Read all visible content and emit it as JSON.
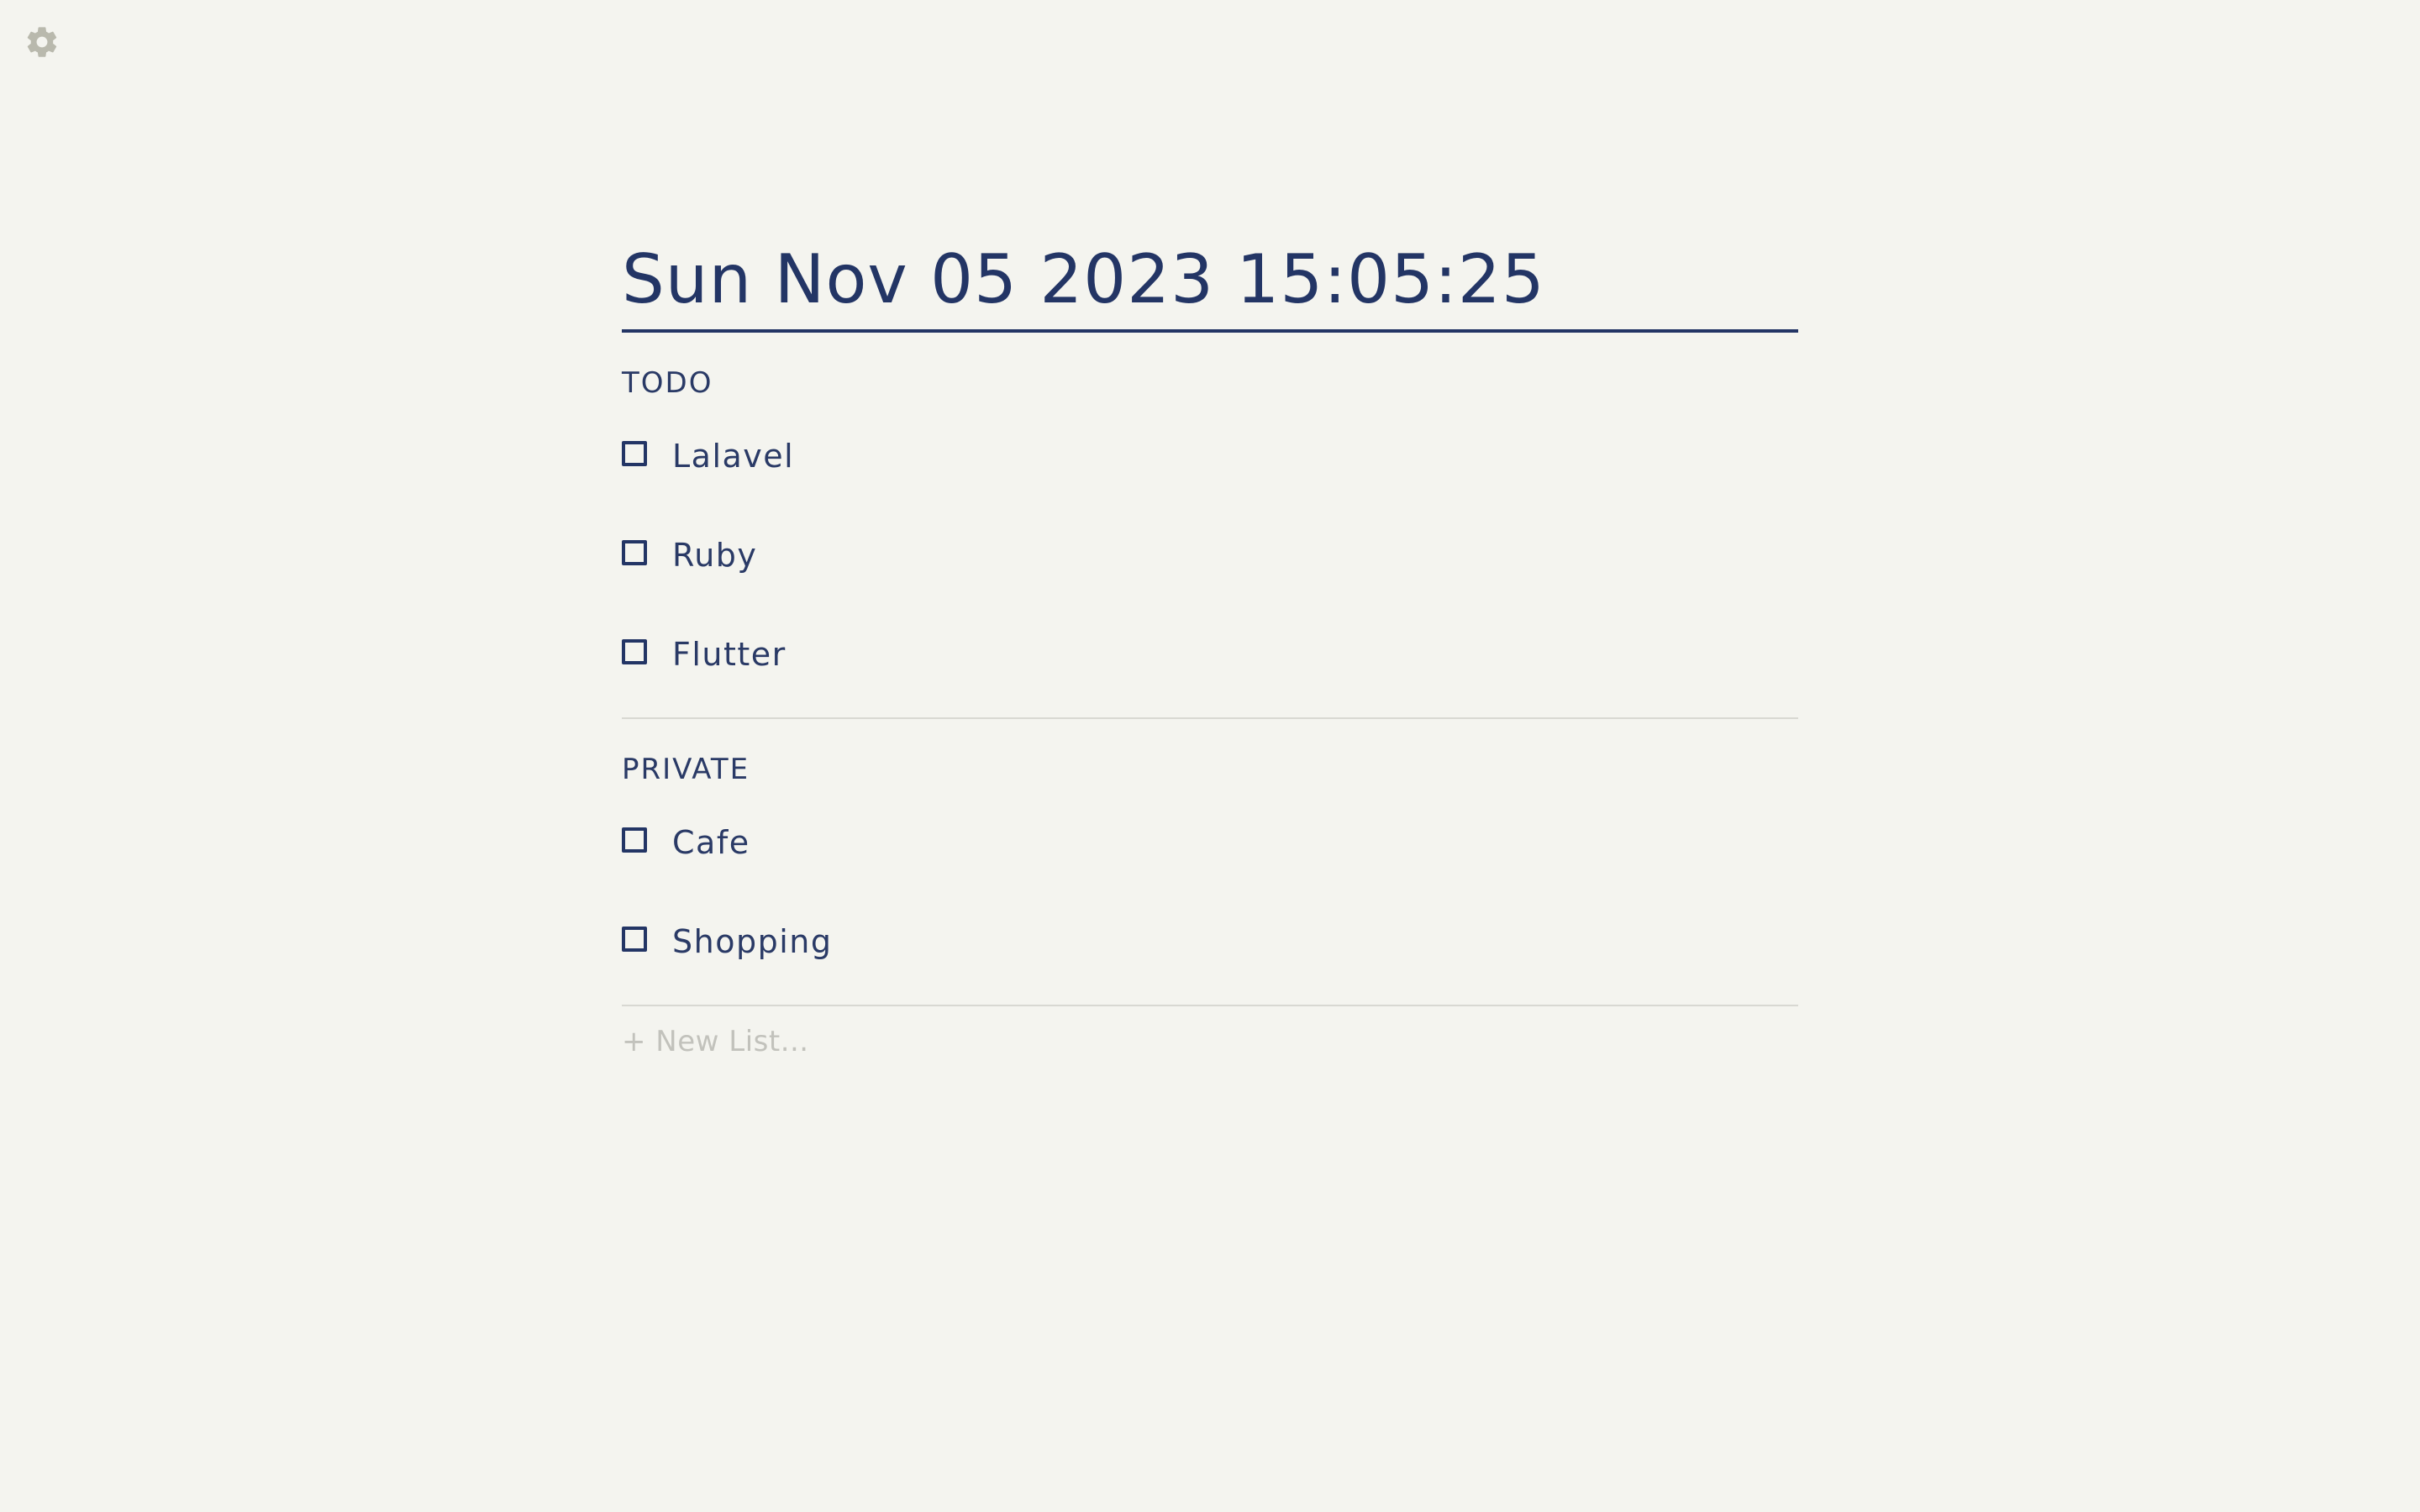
{
  "app": {
    "settings_icon": "gear-icon",
    "colors": {
      "background": "#f4f4ef",
      "text": "#233565",
      "muted": "#c2c2bc",
      "gear": "#b9b9ad",
      "divider": "#d8d8d2"
    }
  },
  "clock": {
    "datetime": "Sun Nov 05 2023 15:05:25"
  },
  "lists": [
    {
      "title": "TODO",
      "items": [
        {
          "label": "Lalavel",
          "checked": false
        },
        {
          "label": "Ruby",
          "checked": false
        },
        {
          "label": "Flutter",
          "checked": false
        }
      ]
    },
    {
      "title": "PRIVATE",
      "items": [
        {
          "label": "Cafe",
          "checked": false
        },
        {
          "label": "Shopping",
          "checked": false
        }
      ]
    }
  ],
  "new_list": {
    "label": "+ New List..."
  }
}
